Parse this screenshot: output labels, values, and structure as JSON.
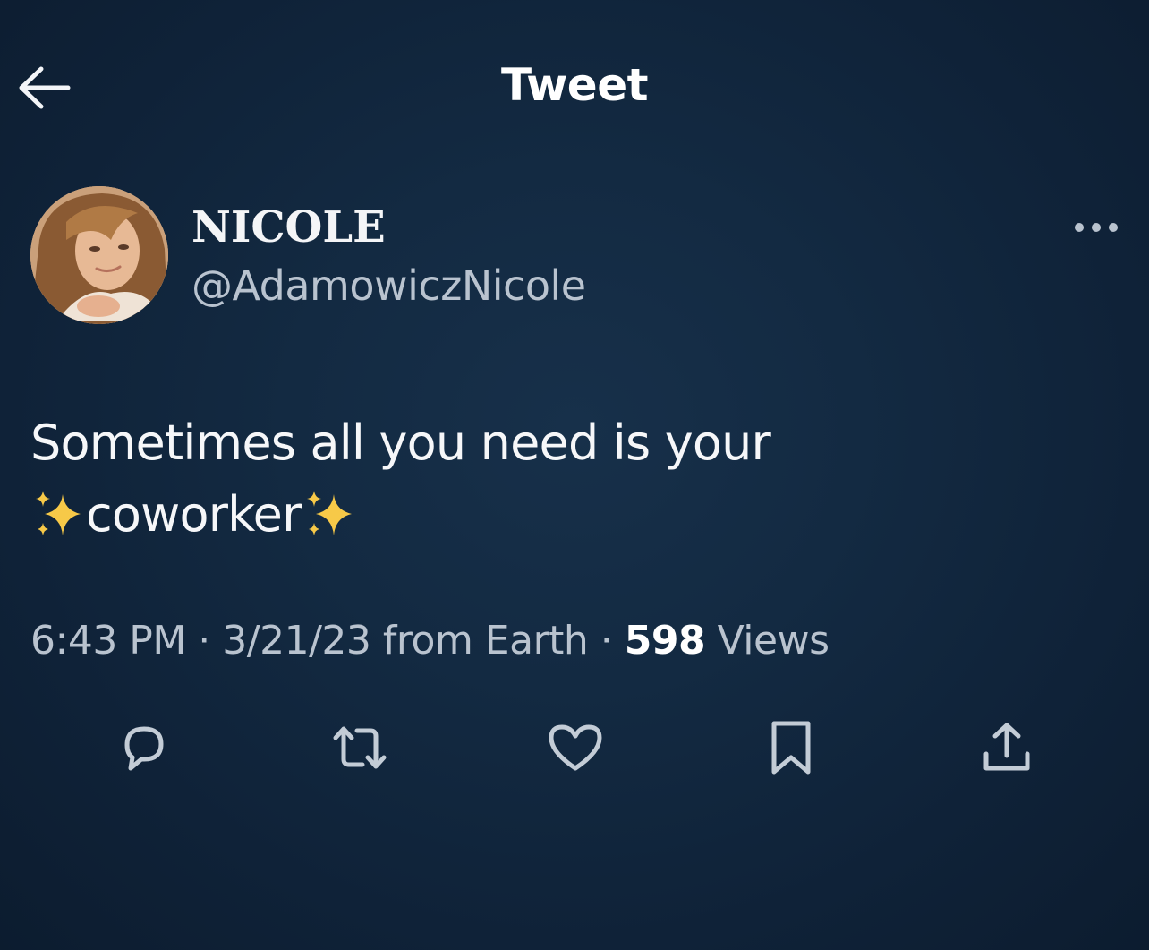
{
  "header": {
    "back_icon": "arrow-left-icon",
    "title": "Tweet"
  },
  "author": {
    "display_name": "NICOLE",
    "handle": "@AdamowiczNicole",
    "avatar_icon": "profile-photo",
    "more_icon": "more-horizontal-icon"
  },
  "tweet": {
    "line1": "Sometimes all you need is your",
    "line2_text": "coworker",
    "emoji": "sparkles-icon"
  },
  "meta": {
    "time": "6:43 PM",
    "sep1": "·",
    "date": "3/21/23",
    "source": "from Earth",
    "sep2": "·",
    "views_count": "598",
    "views_label": "Views"
  },
  "actions": [
    {
      "icon": "reply-icon"
    },
    {
      "icon": "retweet-icon"
    },
    {
      "icon": "like-icon"
    },
    {
      "icon": "bookmark-icon"
    },
    {
      "icon": "share-icon"
    }
  ],
  "colors": {
    "background": "#132a42",
    "text": "#f2f4f7",
    "muted": "#b9c3cf",
    "icon": "#c3ccd6",
    "sparkle": "#f7c948"
  }
}
